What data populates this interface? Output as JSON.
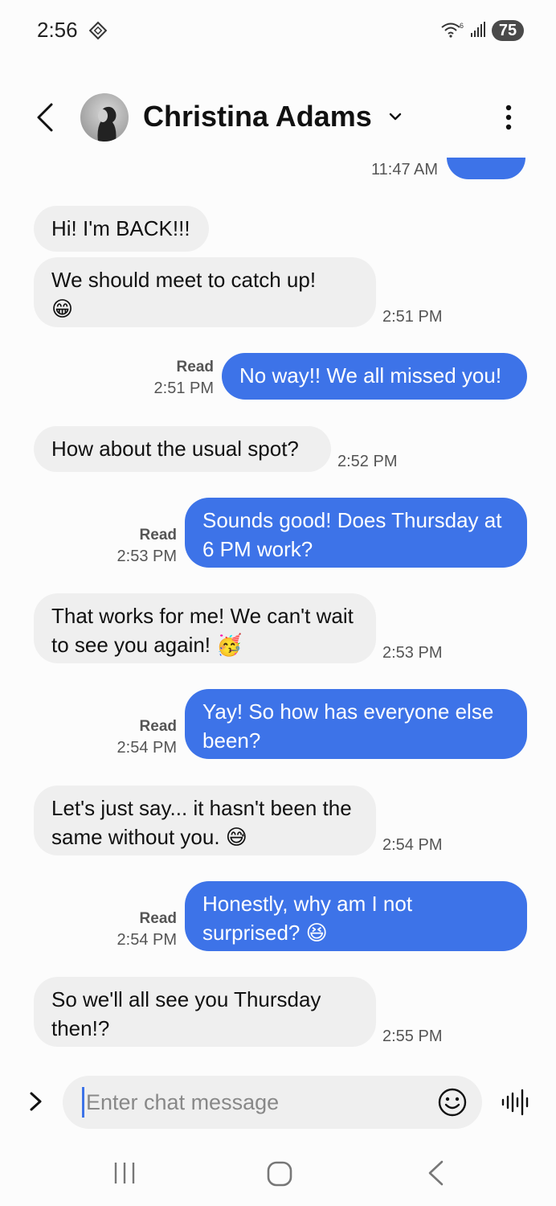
{
  "status_bar": {
    "time": "2:56",
    "battery": "75"
  },
  "header": {
    "contact_name": "Christina Adams"
  },
  "messages": [
    {
      "dir": "out",
      "text": "",
      "time": "11:47 AM"
    },
    {
      "dir": "in",
      "text": "Hi! I'm BACK!!!",
      "time": ""
    },
    {
      "dir": "in",
      "text": "We should meet to catch up!",
      "emoji": "😁",
      "time": "2:51 PM"
    },
    {
      "dir": "out",
      "text": "No way!! We all missed you!",
      "read": "Read",
      "time": "2:51 PM"
    },
    {
      "dir": "in",
      "text": "How about the usual spot?",
      "time": "2:52 PM"
    },
    {
      "dir": "out",
      "text": "Sounds good! Does Thursday at 6 PM work?",
      "read": "Read",
      "time": "2:53 PM"
    },
    {
      "dir": "in",
      "text": "That works for me! We can't wait to see you again!",
      "emoji": "🥳",
      "time": "2:53 PM"
    },
    {
      "dir": "out",
      "text": "Yay! So how has everyone else been?",
      "read": "Read",
      "time": "2:54 PM"
    },
    {
      "dir": "in",
      "text": "Let's just say... it hasn't been the same without you.",
      "emoji": "😅",
      "time": "2:54 PM"
    },
    {
      "dir": "out",
      "text": "Honestly, why am I not surprised?",
      "emoji": "😆",
      "read": "Read",
      "time": "2:54 PM"
    },
    {
      "dir": "in",
      "text": "So we'll all see you Thursday then!?",
      "time": "2:55 PM"
    }
  ],
  "composer": {
    "placeholder": "Enter chat message"
  },
  "colors": {
    "outgoing_bubble": "#3d73e8",
    "incoming_bubble": "#efefef",
    "background": "#fcfcfc"
  },
  "icons": [
    "diamond-icon",
    "wifi-icon",
    "signal-icon",
    "back-icon",
    "chevron-down-icon",
    "more-vert-icon",
    "expand-icon",
    "emoji-icon",
    "voice-icon",
    "recent-apps-icon",
    "home-icon",
    "nav-back-icon"
  ]
}
